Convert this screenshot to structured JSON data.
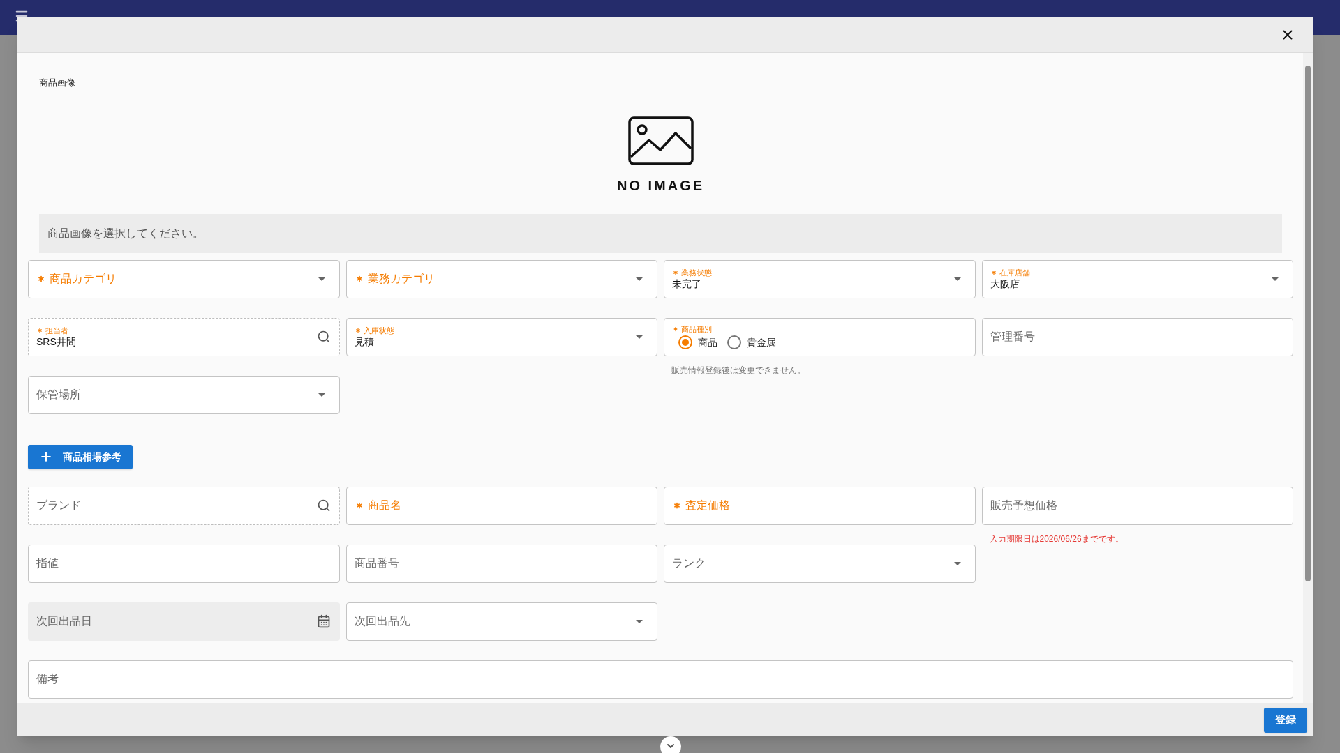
{
  "modal": {
    "image_label": "商品画像",
    "no_image_text": "NO IMAGE",
    "image_hint": "商品画像を選択してください。"
  },
  "rows": [
    {
      "fields": [
        {
          "kind": "select",
          "label": "商品カテゴリ",
          "required": true
        },
        {
          "kind": "select",
          "label": "業務カテゴリ",
          "required": true
        },
        {
          "kind": "select",
          "label": "業務状態",
          "required": true,
          "value": "未完了"
        },
        {
          "kind": "select",
          "label": "在庫店舗",
          "required": true,
          "value": "大阪店"
        }
      ]
    },
    {
      "fields": [
        {
          "kind": "search",
          "label": "担当者",
          "required": true,
          "value": "SRS井間"
        },
        {
          "kind": "select",
          "label": "入庫状態",
          "required": true,
          "value": "見積"
        },
        {
          "kind": "radio",
          "label": "商品種別",
          "required": true,
          "options": [
            {
              "label": "商品",
              "selected": true
            },
            {
              "label": "貴金属",
              "selected": false
            }
          ],
          "helper": {
            "text": "販売情報登録後は変更できません。",
            "kind": "note"
          }
        },
        {
          "kind": "text",
          "label": "管理番号",
          "required": false
        }
      ]
    },
    {
      "fields": [
        {
          "kind": "select",
          "label": "保管場所",
          "required": false
        }
      ]
    },
    {
      "button": {
        "label": "商品相場参考"
      }
    },
    {
      "fields": [
        {
          "kind": "search",
          "label": "ブランド",
          "required": false
        },
        {
          "kind": "text",
          "label": "商品名",
          "required": true
        },
        {
          "kind": "text",
          "label": "査定価格",
          "required": true
        },
        {
          "kind": "text",
          "label": "販売予想価格",
          "required": false,
          "helper": {
            "text": "入力期限日は2026/06/26までです。",
            "kind": "error"
          }
        }
      ]
    },
    {
      "fields": [
        {
          "kind": "text",
          "label": "指値",
          "required": false
        },
        {
          "kind": "text",
          "label": "商品番号",
          "required": false
        },
        {
          "kind": "select",
          "label": "ランク",
          "required": false
        }
      ]
    },
    {
      "fields": [
        {
          "kind": "date",
          "label": "次回出品日",
          "required": false,
          "disabled": true
        },
        {
          "kind": "select",
          "label": "次回出品先",
          "required": false
        }
      ]
    },
    {
      "fields": [
        {
          "kind": "text",
          "label": "備考",
          "required": false,
          "wide": true
        }
      ]
    }
  ],
  "footer": {
    "submit": "登録"
  }
}
